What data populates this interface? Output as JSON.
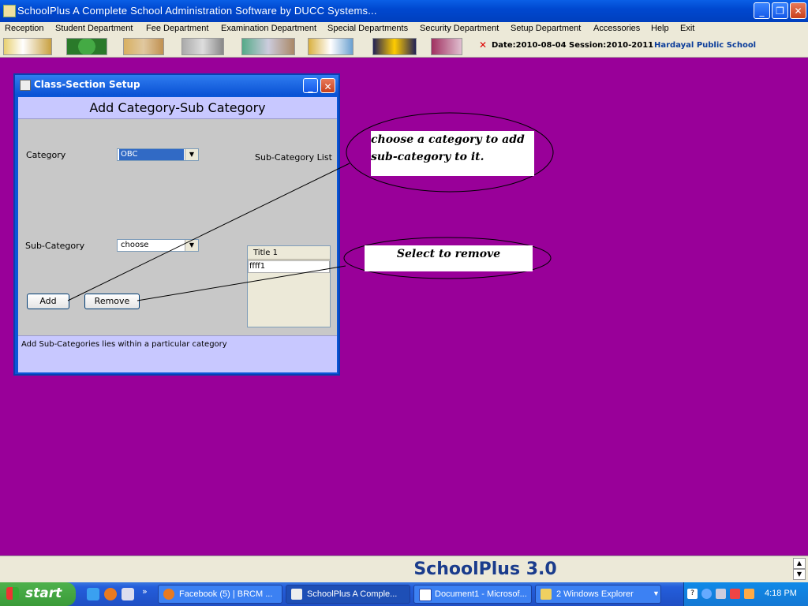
{
  "window": {
    "title": "SchoolPlus   A Complete School Administration Software by DUCC Systems..."
  },
  "menu": [
    "Reception",
    "Student Department",
    "Fee Department",
    "Examination Department",
    "Special Departments",
    "Security Department",
    "Setup Department",
    "Accessories",
    "Help",
    "Exit"
  ],
  "toolbar": {
    "date": "Date:2010-08-04",
    "session": "Session:2010-2011",
    "school": "Hardayal Public School"
  },
  "frame": {
    "title": "Class-Section Setup",
    "header": "Add Category-Sub Category",
    "category_label": "Category",
    "category_value": "OBC",
    "subcategory_label": "Sub-Category",
    "subcategory_value": "choose",
    "list_label": "Sub-Category List",
    "list_column": "Title 1",
    "list_rows": [
      "ffff1"
    ],
    "add_button": "Add",
    "remove_button": "Remove",
    "footer_text": "Add Sub-Categories lies within a particular category"
  },
  "callouts": {
    "category_note": "choose a category to add sub-category to it.",
    "remove_note": "Select to remove"
  },
  "statusbar": {
    "brand": "SchoolPlus 3.0"
  },
  "taskbar": {
    "start": "start",
    "tasks": [
      "Facebook (5) | BRCM ...",
      "SchoolPlus  A Comple...",
      "Document1 - Microsof...",
      "2 Windows Explorer"
    ],
    "clock": "4:18 PM"
  },
  "colors": {
    "desktop": "#990099",
    "header_bg": "#c8c8ff",
    "xp_blue": "#0a56d8"
  }
}
